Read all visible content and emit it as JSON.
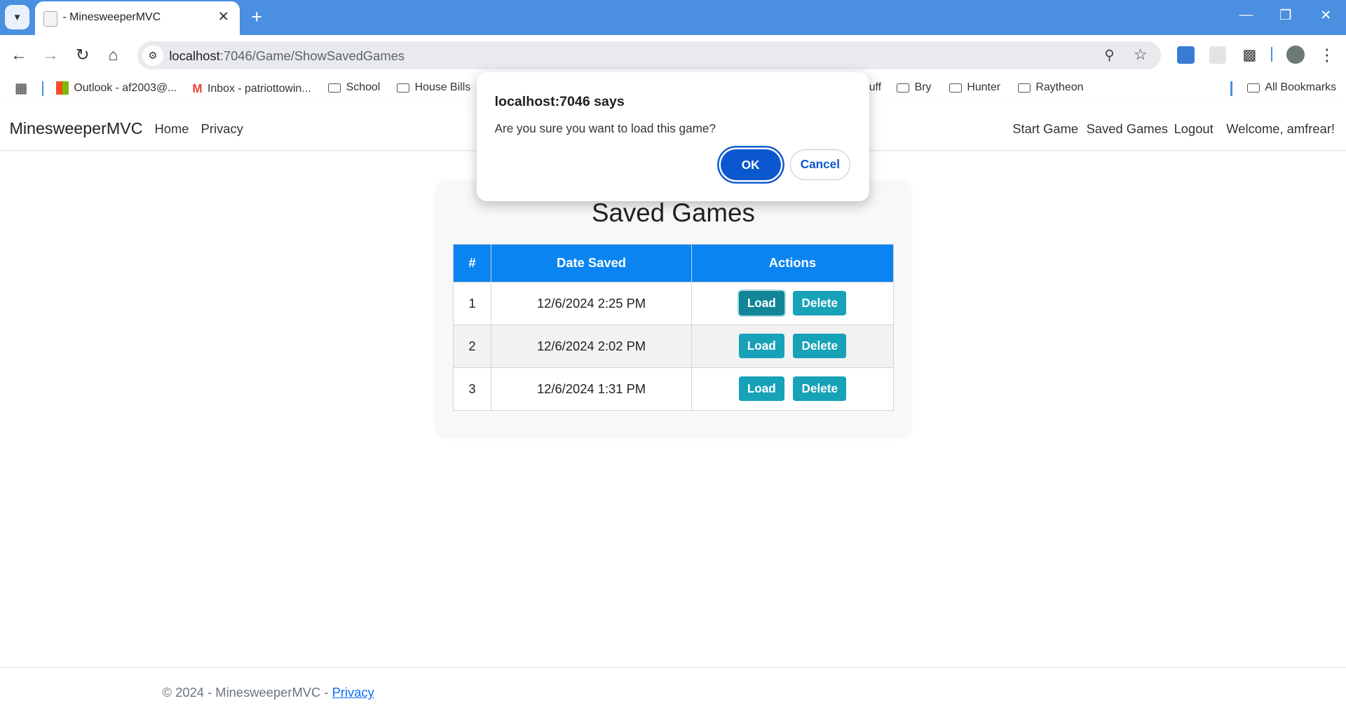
{
  "browser": {
    "tab_title": "- MinesweeperMVC",
    "url_host": "localhost",
    "url_rest": ":7046/Game/ShowSavedGames",
    "bookmarks": [
      {
        "label": "Outlook - af2003@..."
      },
      {
        "label": "Inbox - patriottowin..."
      },
      {
        "label": "School"
      },
      {
        "label": "House Bills"
      },
      {
        "label": "uff"
      },
      {
        "label": "Bry"
      },
      {
        "label": "Hunter"
      },
      {
        "label": "Raytheon"
      }
    ],
    "all_bookmarks": "All Bookmarks"
  },
  "nav": {
    "brand": "MinesweeperMVC",
    "home": "Home",
    "privacy": "Privacy",
    "start_game": "Start Game",
    "saved_games": "Saved Games",
    "logout": "Logout",
    "welcome": "Welcome, amfrear!"
  },
  "main": {
    "title": "Saved Games",
    "columns": [
      "#",
      "Date Saved",
      "Actions"
    ],
    "rows": [
      {
        "num": "1",
        "date": "12/6/2024 2:25 PM",
        "load": "Load",
        "delete": "Delete"
      },
      {
        "num": "2",
        "date": "12/6/2024 2:02 PM",
        "load": "Load",
        "delete": "Delete"
      },
      {
        "num": "3",
        "date": "12/6/2024 1:31 PM",
        "load": "Load",
        "delete": "Delete"
      }
    ]
  },
  "footer": {
    "text": "© 2024 - MinesweeperMVC - ",
    "privacy": "Privacy"
  },
  "dialog": {
    "title": "localhost:7046 says",
    "message": "Are you sure you want to load this game?",
    "ok": "OK",
    "cancel": "Cancel"
  }
}
